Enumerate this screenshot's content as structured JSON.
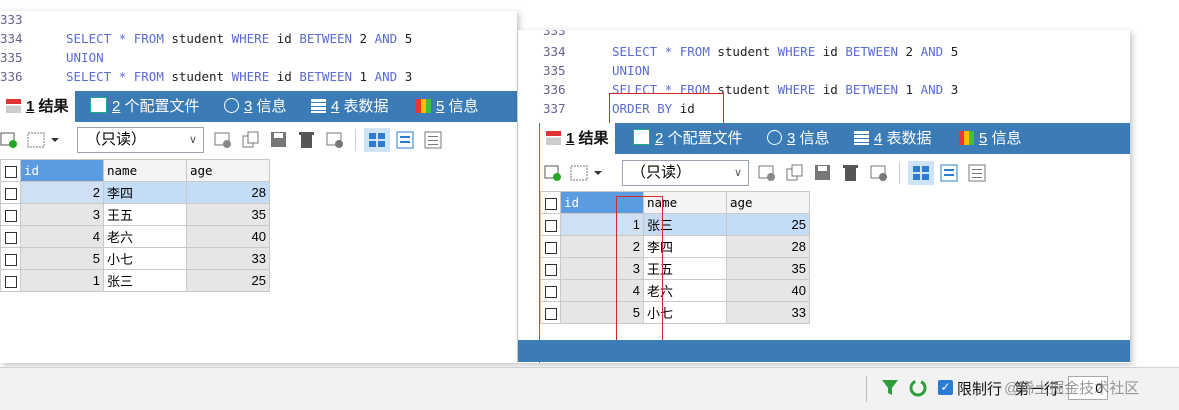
{
  "left_window": {
    "editor": [
      {
        "ln": "333",
        "segments": []
      },
      {
        "ln": "334",
        "segments": [
          {
            "t": "SELECT",
            "kw": true
          },
          {
            "t": " "
          },
          {
            "t": "*",
            "kw": true
          },
          {
            "t": " "
          },
          {
            "t": "FROM",
            "kw": true
          },
          {
            "t": " student "
          },
          {
            "t": "WHERE",
            "kw": true
          },
          {
            "t": " id "
          },
          {
            "t": "BETWEEN",
            "kw": true
          },
          {
            "t": " 2 "
          },
          {
            "t": "AND",
            "kw": true
          },
          {
            "t": " 5"
          }
        ]
      },
      {
        "ln": "335",
        "segments": [
          {
            "t": "UNION",
            "kw": true
          }
        ]
      },
      {
        "ln": "336",
        "segments": [
          {
            "t": "SELECT",
            "kw": true
          },
          {
            "t": " "
          },
          {
            "t": "*",
            "kw": true
          },
          {
            "t": " "
          },
          {
            "t": "FROM",
            "kw": true
          },
          {
            "t": " student "
          },
          {
            "t": "WHERE",
            "kw": true
          },
          {
            "t": " id "
          },
          {
            "t": "BETWEEN",
            "kw": true
          },
          {
            "t": " 1 "
          },
          {
            "t": "AND",
            "kw": true
          },
          {
            "t": " 3"
          }
        ]
      }
    ],
    "tabs": [
      {
        "num": "1",
        "label": " 结果"
      },
      {
        "num": "2",
        "label": " 个配置文件"
      },
      {
        "num": "3",
        "label": " 信息"
      },
      {
        "num": "4",
        "label": " 表数据"
      },
      {
        "num": "5",
        "label": " 信息"
      }
    ],
    "readonly_select": "（只读）",
    "columns": [
      "id",
      "name",
      "age"
    ],
    "rows": [
      {
        "id": "2",
        "name": "李四",
        "age": "28"
      },
      {
        "id": "3",
        "name": "王五",
        "age": "35"
      },
      {
        "id": "4",
        "name": "老六",
        "age": "40"
      },
      {
        "id": "5",
        "name": "小七",
        "age": "33"
      },
      {
        "id": "1",
        "name": "张三",
        "age": "25"
      }
    ]
  },
  "right_window": {
    "editor": [
      {
        "ln": "333",
        "segments": []
      },
      {
        "ln": "334",
        "segments": [
          {
            "t": "SELECT",
            "kw": true
          },
          {
            "t": " "
          },
          {
            "t": "*",
            "kw": true
          },
          {
            "t": " "
          },
          {
            "t": "FROM",
            "kw": true
          },
          {
            "t": " student "
          },
          {
            "t": "WHERE",
            "kw": true
          },
          {
            "t": " id "
          },
          {
            "t": "BETWEEN",
            "kw": true
          },
          {
            "t": " 2 "
          },
          {
            "t": "AND",
            "kw": true
          },
          {
            "t": " 5"
          }
        ]
      },
      {
        "ln": "335",
        "segments": [
          {
            "t": "UNION",
            "kw": true
          }
        ]
      },
      {
        "ln": "336",
        "segments": [
          {
            "t": "SELECT",
            "kw": true
          },
          {
            "t": " "
          },
          {
            "t": "*",
            "kw": true
          },
          {
            "t": " "
          },
          {
            "t": "FROM",
            "kw": true
          },
          {
            "t": " student "
          },
          {
            "t": "WHERE",
            "kw": true
          },
          {
            "t": " id "
          },
          {
            "t": "BETWEEN",
            "kw": true
          },
          {
            "t": " 1 "
          },
          {
            "t": "AND",
            "kw": true
          },
          {
            "t": " 3"
          }
        ]
      },
      {
        "ln": "337",
        "segments": [
          {
            "t": "ORDER BY",
            "kw": true
          },
          {
            "t": " id"
          }
        ]
      }
    ],
    "tabs": [
      {
        "num": "1",
        "label": " 结果"
      },
      {
        "num": "2",
        "label": " 个配置文件"
      },
      {
        "num": "3",
        "label": " 信息"
      },
      {
        "num": "4",
        "label": " 表数据"
      },
      {
        "num": "5",
        "label": " 信息"
      }
    ],
    "readonly_select": "（只读）",
    "columns": [
      "id",
      "name",
      "age"
    ],
    "rows": [
      {
        "id": "1",
        "name": "张三",
        "age": "25"
      },
      {
        "id": "2",
        "name": "李四",
        "age": "28"
      },
      {
        "id": "3",
        "name": "王五",
        "age": "35"
      },
      {
        "id": "4",
        "name": "老六",
        "age": "40"
      },
      {
        "id": "5",
        "name": "小七",
        "age": "33"
      }
    ]
  },
  "status_bar": {
    "limit_label": "限制行",
    "first_row_label": "第一行:",
    "first_row_value": "0",
    "watermark": "@稀土掘金技术社区"
  },
  "colors": {
    "tab_bar": "#3b7cb6",
    "keyword": "#5a6bd6",
    "highlight_box": "#d42a2a",
    "selected_cell": "#c5dcf7"
  }
}
